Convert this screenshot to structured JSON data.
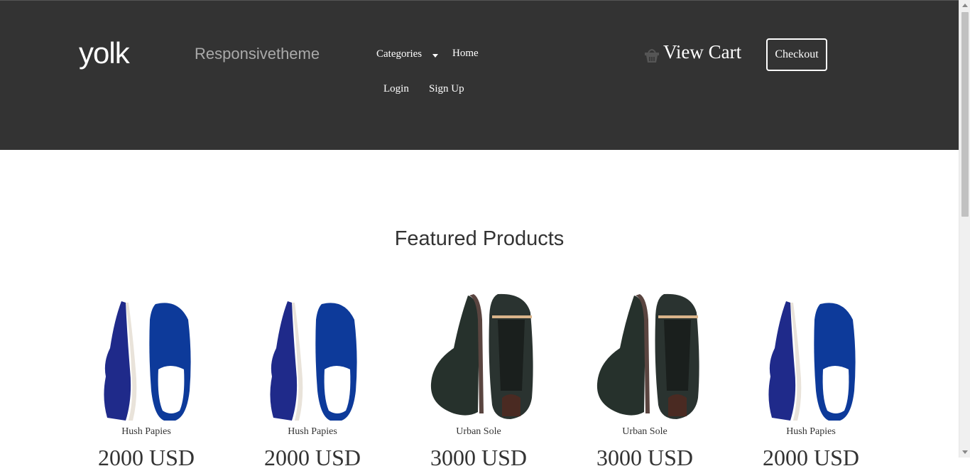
{
  "header": {
    "logo": "yolk",
    "tagline": "Responsivetheme",
    "nav": {
      "categories": "Categories",
      "home": "Home",
      "login": "Login",
      "signup": "Sign Up"
    },
    "view_cart": "View Cart",
    "checkout": "Checkout"
  },
  "featured": {
    "title": "Featured Products",
    "products": [
      {
        "name": "Hush Papies",
        "price": "2000 USD",
        "image": "blue-loafer"
      },
      {
        "name": "Hush Papies",
        "price": "2000 USD",
        "image": "blue-loafer"
      },
      {
        "name": "Urban Sole",
        "price": "3000 USD",
        "image": "black-hightop"
      },
      {
        "name": "Urban Sole",
        "price": "3000 USD",
        "image": "black-hightop"
      },
      {
        "name": "Hush Papies",
        "price": "2000 USD",
        "image": "blue-loafer"
      }
    ]
  },
  "colors": {
    "header_bg": "#333333",
    "text": "#333333",
    "tagline": "#a9a9a9"
  }
}
